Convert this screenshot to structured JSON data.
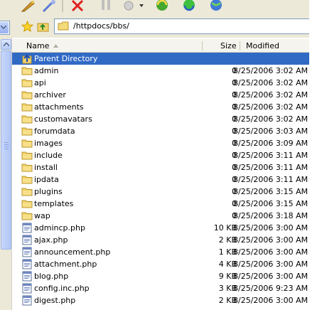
{
  "address": {
    "path": "/httpdocs/bbs/"
  },
  "columns": {
    "name": "Name",
    "size": "Size",
    "modified": "Modified"
  },
  "rows": [
    {
      "name": "Parent Directory",
      "size": "",
      "modified": "",
      "type": "up",
      "selected": true
    },
    {
      "name": "admin",
      "size": "0",
      "modified": "8/25/2006 3:02 AM",
      "type": "folder"
    },
    {
      "name": "api",
      "size": "0",
      "modified": "8/25/2006 3:02 AM",
      "type": "folder"
    },
    {
      "name": "archiver",
      "size": "0",
      "modified": "8/25/2006 3:02 AM",
      "type": "folder"
    },
    {
      "name": "attachments",
      "size": "0",
      "modified": "8/25/2006 3:02 AM",
      "type": "folder"
    },
    {
      "name": "customavatars",
      "size": "0",
      "modified": "8/25/2006 3:02 AM",
      "type": "folder"
    },
    {
      "name": "forumdata",
      "size": "0",
      "modified": "8/25/2006 3:03 AM",
      "type": "folder"
    },
    {
      "name": "images",
      "size": "0",
      "modified": "8/25/2006 3:09 AM",
      "type": "folder"
    },
    {
      "name": "include",
      "size": "0",
      "modified": "8/25/2006 3:11 AM",
      "type": "folder"
    },
    {
      "name": "install",
      "size": "0",
      "modified": "8/25/2006 3:11 AM",
      "type": "folder"
    },
    {
      "name": "ipdata",
      "size": "0",
      "modified": "8/25/2006 3:11 AM",
      "type": "folder"
    },
    {
      "name": "plugins",
      "size": "0",
      "modified": "8/25/2006 3:15 AM",
      "type": "folder"
    },
    {
      "name": "templates",
      "size": "0",
      "modified": "8/25/2006 3:15 AM",
      "type": "folder"
    },
    {
      "name": "wap",
      "size": "0",
      "modified": "8/25/2006 3:18 AM",
      "type": "folder"
    },
    {
      "name": "admincp.php",
      "size": "10 KB",
      "modified": "8/25/2006 3:00 AM",
      "type": "file"
    },
    {
      "name": "ajax.php",
      "size": "2 KB",
      "modified": "8/25/2006 3:00 AM",
      "type": "file"
    },
    {
      "name": "announcement.php",
      "size": "1 KB",
      "modified": "8/25/2006 3:00 AM",
      "type": "file"
    },
    {
      "name": "attachment.php",
      "size": "4 KB",
      "modified": "8/25/2006 3:00 AM",
      "type": "file"
    },
    {
      "name": "blog.php",
      "size": "9 KB",
      "modified": "8/25/2006 3:00 AM",
      "type": "file"
    },
    {
      "name": "config.inc.php",
      "size": "3 KB",
      "modified": "8/25/2006 9:23 AM",
      "type": "file"
    },
    {
      "name": "digest.php",
      "size": "2 KB",
      "modified": "8/25/2006 3:00 AM",
      "type": "file"
    }
  ],
  "colors": {
    "selection": "#316ac5",
    "chrome": "#ece9d8",
    "folder": "#f3d36b"
  }
}
